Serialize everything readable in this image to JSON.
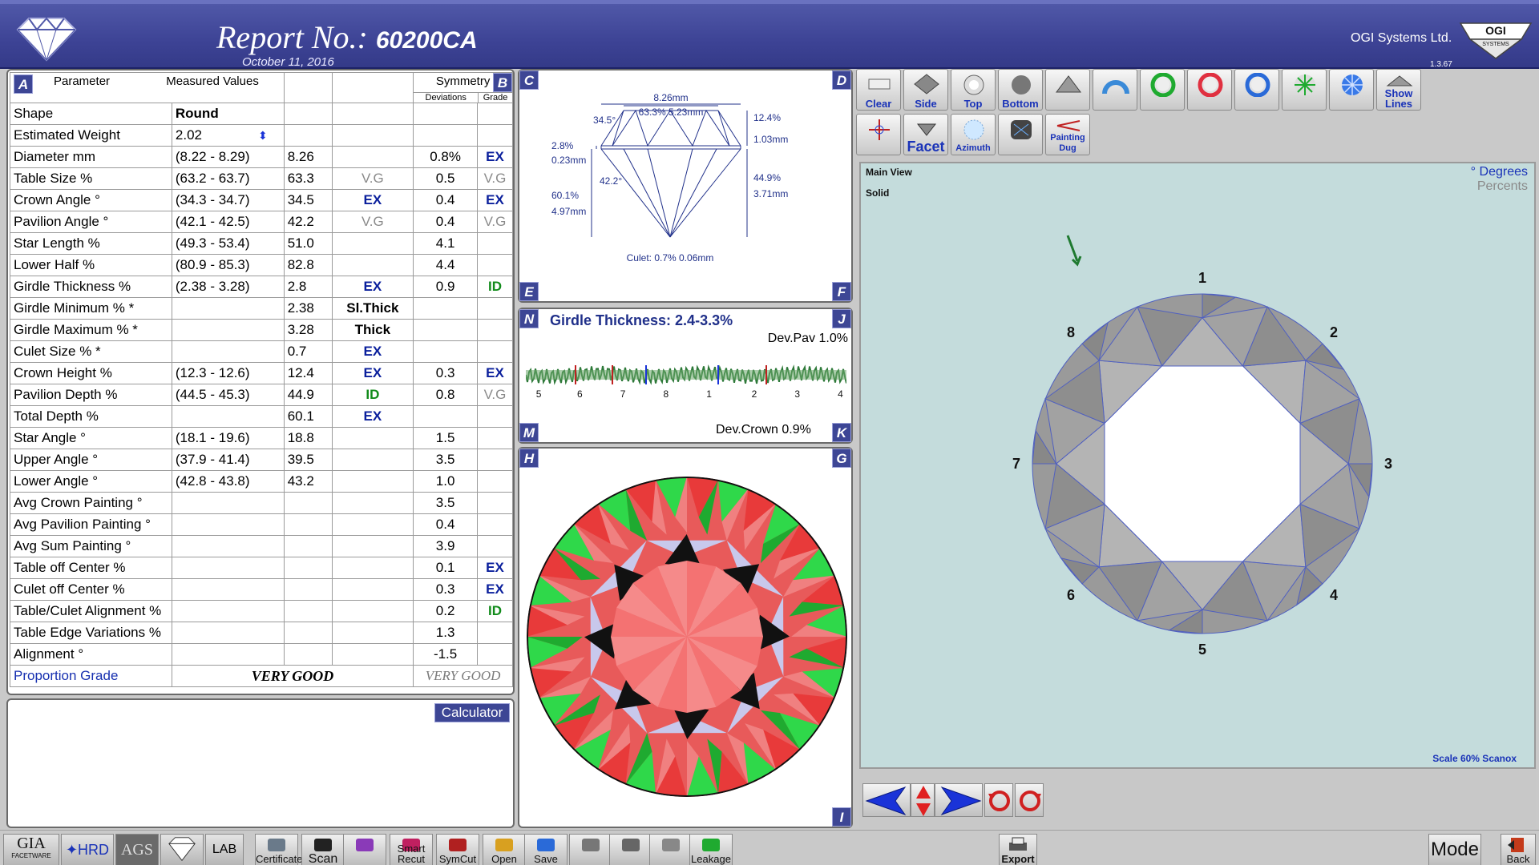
{
  "header": {
    "title_prefix": "Report No.: ",
    "report_number": "60200CA",
    "date": "October 11, 2016",
    "company": "OGI Systems Ltd.",
    "ogi_logo_text": "OGI",
    "ogi_logo_sub": "SYSTEMS",
    "version": "1.3.67"
  },
  "table": {
    "corner_a": "A",
    "corner_b": "B",
    "col_parameter": "Parameter",
    "col_measured": "Measured Values",
    "col_symmetry": "Symmetry",
    "col_deviations": "Deviations",
    "col_grade": "Grade",
    "rows": [
      {
        "name": "Shape",
        "range": "Round",
        "value": "",
        "grade": "",
        "dev": "",
        "sgrade": ""
      },
      {
        "name": "Estimated Weight",
        "range": "2.02",
        "value": "",
        "grade": "",
        "dev": "",
        "sgrade": ""
      },
      {
        "name": "Diameter  mm",
        "range": "(8.22 - 8.29)",
        "value": "8.26",
        "grade": "",
        "dev": "0.8%",
        "sgrade": "EX"
      },
      {
        "name": "Table Size  %",
        "range": "(63.2 - 63.7)",
        "value": "63.3",
        "grade": "V.G",
        "dev": "0.5",
        "sgrade": "V.G"
      },
      {
        "name": "Crown Angle  °",
        "range": "(34.3 - 34.7)",
        "value": "34.5",
        "grade": "EX",
        "dev": "0.4",
        "sgrade": "EX"
      },
      {
        "name": "Pavilion Angle  °",
        "range": "(42.1 - 42.5)",
        "value": "42.2",
        "grade": "V.G",
        "dev": "0.4",
        "sgrade": "V.G"
      },
      {
        "name": "Star Length  %",
        "range": "(49.3 - 53.4)",
        "value": "51.0",
        "grade": "",
        "dev": "4.1",
        "sgrade": ""
      },
      {
        "name": "Lower Half  %",
        "range": "(80.9 - 85.3)",
        "value": "82.8",
        "grade": "",
        "dev": "4.4",
        "sgrade": ""
      },
      {
        "name": "Girdle Thickness  %",
        "range": "(2.38 - 3.28)",
        "value": "2.8",
        "grade": "EX",
        "dev": "0.9",
        "sgrade": "ID"
      },
      {
        "name": "Girdle Minimum  % *",
        "range": "",
        "value": "2.38",
        "grade": "Sl.Thick",
        "dev": "",
        "sgrade": ""
      },
      {
        "name": "Girdle Maximum  % *",
        "range": "",
        "value": "3.28",
        "grade": "Thick",
        "dev": "",
        "sgrade": ""
      },
      {
        "name": "Culet Size  % *",
        "range": "",
        "value": "0.7",
        "grade": "EX",
        "dev": "",
        "sgrade": ""
      },
      {
        "name": "Crown Height  %",
        "range": "(12.3 - 12.6)",
        "value": "12.4",
        "grade": "EX",
        "dev": "0.3",
        "sgrade": "EX"
      },
      {
        "name": "Pavilion Depth  %",
        "range": "(44.5 - 45.3)",
        "value": "44.9",
        "grade": "ID",
        "dev": "0.8",
        "sgrade": "V.G"
      },
      {
        "name": "Total Depth  %",
        "range": "",
        "value": "60.1",
        "grade": "EX",
        "dev": "",
        "sgrade": ""
      },
      {
        "name": "Star Angle °",
        "range": "(18.1 - 19.6)",
        "value": "18.8",
        "grade": "",
        "dev": "1.5",
        "sgrade": ""
      },
      {
        "name": "Upper Angle °",
        "range": "(37.9 - 41.4)",
        "value": "39.5",
        "grade": "",
        "dev": "3.5",
        "sgrade": ""
      },
      {
        "name": "Lower Angle °",
        "range": "(42.8 - 43.8)",
        "value": "43.2",
        "grade": "",
        "dev": "1.0",
        "sgrade": ""
      },
      {
        "name": "Avg Crown Painting °",
        "range": "",
        "value": "",
        "grade": "",
        "dev": "3.5",
        "sgrade": ""
      },
      {
        "name": "Avg Pavilion Painting °",
        "range": "",
        "value": "",
        "grade": "",
        "dev": "0.4",
        "sgrade": ""
      },
      {
        "name": "Avg Sum Painting °",
        "range": "",
        "value": "",
        "grade": "",
        "dev": "3.9",
        "sgrade": ""
      },
      {
        "name": "Table off Center %",
        "range": "",
        "value": "",
        "grade": "",
        "dev": "0.1",
        "sgrade": "EX"
      },
      {
        "name": "Culet off Center %",
        "range": "",
        "value": "",
        "grade": "",
        "dev": "0.3",
        "sgrade": "EX"
      },
      {
        "name": "Table/Culet Alignment %",
        "range": "",
        "value": "",
        "grade": "",
        "dev": "0.2",
        "sgrade": "ID"
      },
      {
        "name": "Table Edge Variations %",
        "range": "",
        "value": "",
        "grade": "",
        "dev": "1.3",
        "sgrade": ""
      },
      {
        "name": "Alignment °",
        "range": "",
        "value": "",
        "grade": "",
        "dev": "-1.5",
        "sgrade": ""
      }
    ],
    "proportion_label": "Proportion Grade",
    "proportion_grade": "VERY GOOD",
    "symmetry_grade": "VERY GOOD"
  },
  "notes": {
    "calculator_label": "Calculator"
  },
  "profile": {
    "corners": [
      "C",
      "D",
      "E",
      "F"
    ],
    "diameter": "8.26mm",
    "table": "63.3% 5.23mm",
    "crown_angle": "34.5°",
    "crown_height_pct": "12.4%",
    "crown_height_mm": "1.03mm",
    "girdle_pct": "2.8%",
    "girdle_mm": "0.23mm",
    "pavilion_angle": "42.2°",
    "pavilion_depth_pct": "44.9%",
    "pavilion_depth_mm": "3.71mm",
    "total_depth_pct": "60.1%",
    "total_depth_mm": "4.97mm",
    "culet": "Culet: 0.7% 0.06mm"
  },
  "girdle": {
    "corners": [
      "N",
      "J",
      "M",
      "K"
    ],
    "title": "Girdle Thickness: 2.4-3.3%",
    "dev_pav": "Dev.Pav 1.0%",
    "dev_crown": "Dev.Crown 0.9%",
    "markers": [
      "5",
      "6",
      "7",
      "8",
      "1",
      "2",
      "3",
      "4"
    ]
  },
  "aset": {
    "corners": [
      "H",
      "G",
      "I"
    ]
  },
  "toolbar": {
    "row1": [
      "Clear",
      "Side",
      "Top",
      "Bottom",
      "",
      "",
      "",
      "",
      "",
      "",
      "",
      "Show Lines"
    ],
    "row2": [
      "",
      "Facet",
      "Azimuth",
      "",
      "Painting Dug"
    ]
  },
  "main_view": {
    "title": "Main View",
    "mode": "Solid",
    "units_selected": "° Degrees",
    "units_other": "Percents",
    "scale": "Scale 60% Scanox",
    "dir_labels": [
      "1",
      "2",
      "3",
      "4",
      "5",
      "6",
      "7",
      "8"
    ]
  },
  "bottom_bar": {
    "logos": [
      "GIA",
      "HRD",
      "AGS",
      "",
      "LAB"
    ],
    "gia_sub": "FACETWARE",
    "buttons": [
      "Certificate",
      "Scan",
      "",
      "Smart Recut",
      "SymCut",
      "Open",
      "Save",
      "",
      "",
      "",
      "Leakage"
    ],
    "export": "Export",
    "mode": "Mode",
    "back": "Back"
  },
  "colors": {
    "accent": "#3d4695",
    "grade_ex": "#0a1f9c",
    "grade_id": "#118b1a",
    "view_bg": "#c4dcdc"
  }
}
